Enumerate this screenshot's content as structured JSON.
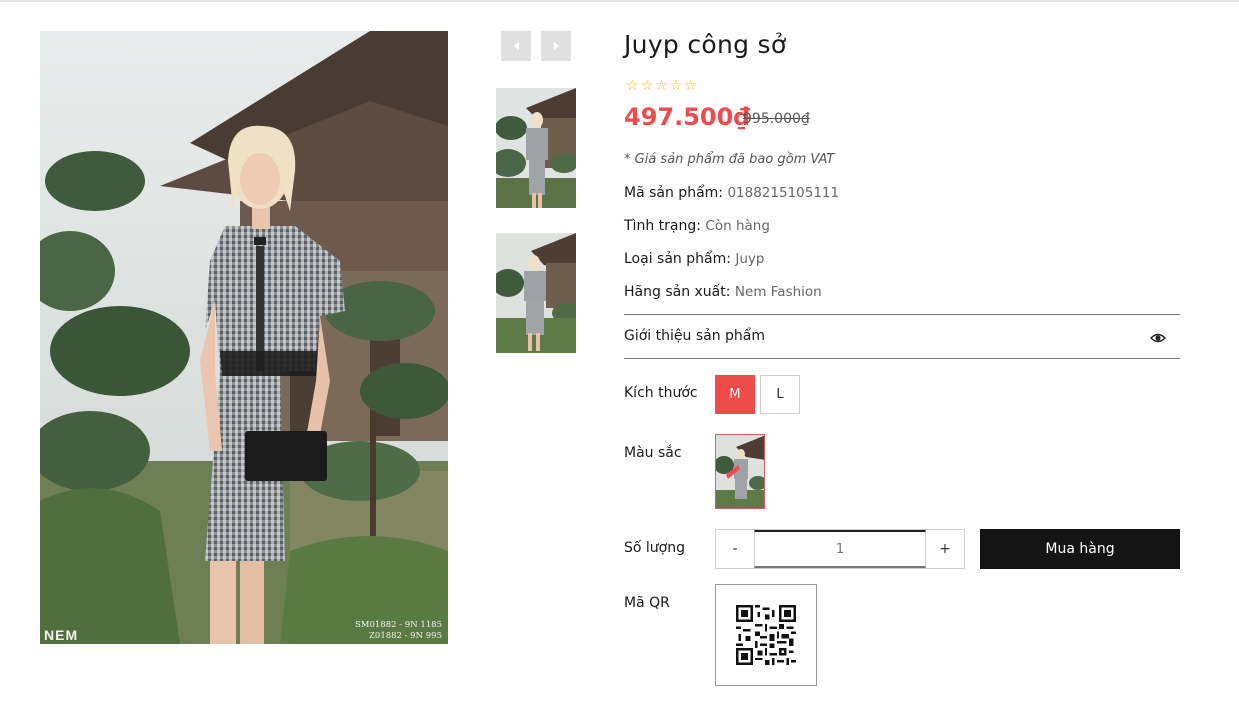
{
  "gallery": {
    "photo_code_line1": "SM01882 - 9N 1185",
    "photo_code_line2": "Z01882 - 9N 995",
    "photo_logo": "NEM",
    "prev_icon": "caret-left-icon",
    "next_icon": "caret-right-icon"
  },
  "product": {
    "title": "Juyp công sở",
    "rating_stars": 5,
    "rating_value": 0,
    "price": "497.500₫",
    "old_price": "995.000₫",
    "vat_note": "* Giá sản phẩm đã bao gồm VAT",
    "sku_label": "Mã sản phẩm:",
    "sku_value": "0188215105111",
    "status_label": "Tình trạng:",
    "status_value": "Còn hàng",
    "type_label": "Loại sản phẩm:",
    "type_value": "Juyp",
    "brand_label": "Hãng sản xuất:",
    "brand_value": "Nem Fashion"
  },
  "intro": {
    "label": "Giới thiệu sản phẩm",
    "icon": "eye-icon"
  },
  "options": {
    "size_label": "Kích thước",
    "sizes": [
      "M",
      "L"
    ],
    "selected_size": "M",
    "color_label": "Màu sắc",
    "quantity_label": "Số lượng",
    "qty_minus": "-",
    "qty_plus": "+",
    "quantity_value": "1",
    "buy_label": "Mua hàng",
    "qr_label": "Mã QR"
  },
  "colors": {
    "accent": "#f04b4b",
    "buy_button": "#151515",
    "star": "#f4b400"
  }
}
